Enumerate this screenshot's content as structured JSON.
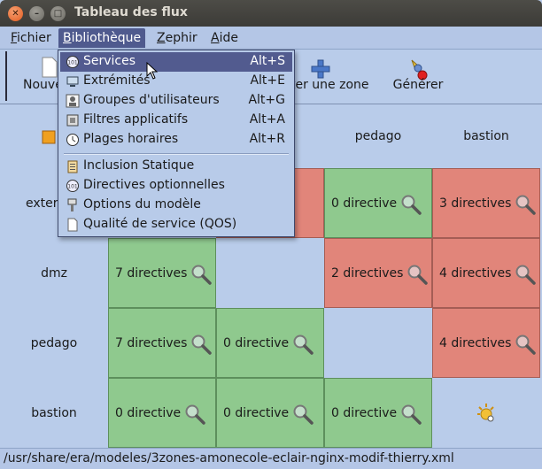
{
  "window": {
    "title": "Tableau des flux"
  },
  "menubar": {
    "items": [
      {
        "label": "Fichier",
        "mnemonic": "F",
        "rest": "ichier"
      },
      {
        "label": "Bibliothèque",
        "mnemonic": "B",
        "rest": "ibliothèque"
      },
      {
        "label": "Zephir",
        "mnemonic": "Z",
        "rest": "ephir"
      },
      {
        "label": "Aide",
        "mnemonic": "A",
        "rest": "ide"
      }
    ]
  },
  "toolbar": {
    "new_label": "Nouve",
    "add_zone_label": "ter une zone",
    "generate_label": "Générer"
  },
  "dropdown": {
    "items": [
      {
        "label": "Services",
        "accel": "Alt+S"
      },
      {
        "label": "Extrémités",
        "accel": "Alt+E"
      },
      {
        "label": "Groupes d'utilisateurs",
        "accel": "Alt+G"
      },
      {
        "label": "Filtres applicatifs",
        "accel": "Alt+A"
      },
      {
        "label": "Plages horaires",
        "accel": "Alt+R"
      },
      {
        "label": "Inclusion Statique",
        "accel": ""
      },
      {
        "label": "Directives optionnelles",
        "accel": ""
      },
      {
        "label": "Options du modèle",
        "accel": ""
      },
      {
        "label": "Qualité de service (QOS)",
        "accel": ""
      }
    ]
  },
  "grid": {
    "col_headers": [
      "pedago",
      "bastion"
    ],
    "row_headers": [
      "exter",
      "dmz",
      "pedago",
      "bastion"
    ],
    "cells": {
      "r0c2": "0 directive",
      "r0c3": "3 directives",
      "r1c0": "7 directives",
      "r1c2": "2 directives",
      "r1c3": "4 directives",
      "r2c0": "7 directives",
      "r2c1": "0 directive",
      "r2c3": "4 directives",
      "r3c0": "0 directive",
      "r3c1": "0 directive",
      "r3c2": "0 directive"
    }
  },
  "statusbar": {
    "path": "/usr/share/era/modeles/3zones-amonecole-eclair-nginx-modif-thierry.xml"
  },
  "colors": {
    "green": "#8fc98e",
    "red": "#e1857a",
    "highlight": "#525b8f",
    "background": "#b9ccea"
  }
}
